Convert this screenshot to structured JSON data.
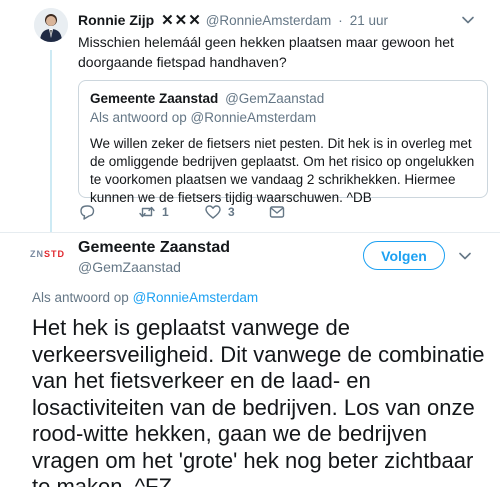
{
  "reply_tweet": {
    "author_name": "Ronnie Zijp",
    "author_badge": "✕✕✕",
    "author_handle": "@RonnieAmsterdam",
    "time": "21 uur",
    "text": "Misschien helemáál geen hekken plaatsen maar gewoon het doorgaande fietspad handhaven?",
    "quote": {
      "author_name": "Gemeente Zaanstad",
      "author_handle": "@GemZaanstad",
      "reply_context": "Als antwoord op @RonnieAmsterdam",
      "text": "We willen zeker de fietsers niet pesten. Dit hek is in overleg met de omliggende bedrijven geplaatst. Om het risico op ongelukken te voorkomen plaatsen we vandaag 2 schrikhekken. Hiermee kunnen we de fietsers tijdig waarschuwen. ^DB"
    },
    "actions": {
      "reply_icon": "reply-icon",
      "retweet_icon": "retweet-icon",
      "retweet_count": "1",
      "like_icon": "heart-icon",
      "like_count": "3",
      "mail_icon": "envelope-icon"
    }
  },
  "main_tweet": {
    "logo_part1": "ZN",
    "logo_part2": "STD",
    "author_name": "Gemeente Zaanstad",
    "author_handle": "@GemZaanstad",
    "follow_label": "Volgen",
    "reply_prefix": "Als antwoord op",
    "reply_mention": "@RonnieAmsterdam",
    "text": "Het hek is geplaatst vanwege de verkeersveiligheid. Dit vanwege de combinatie van het fietsverkeer en de laad- en losactiviteiten van de bedrijven. Los van onze rood-witte hekken, gaan we de bedrijven vragen om het 'grote' hek nog beter zichtbaar te maken. ^FZ"
  },
  "colors": {
    "accent": "#1da1f2",
    "secondary_text": "#657786",
    "thread_line": "#cdeaf4",
    "logo_red": "#e0282f"
  }
}
